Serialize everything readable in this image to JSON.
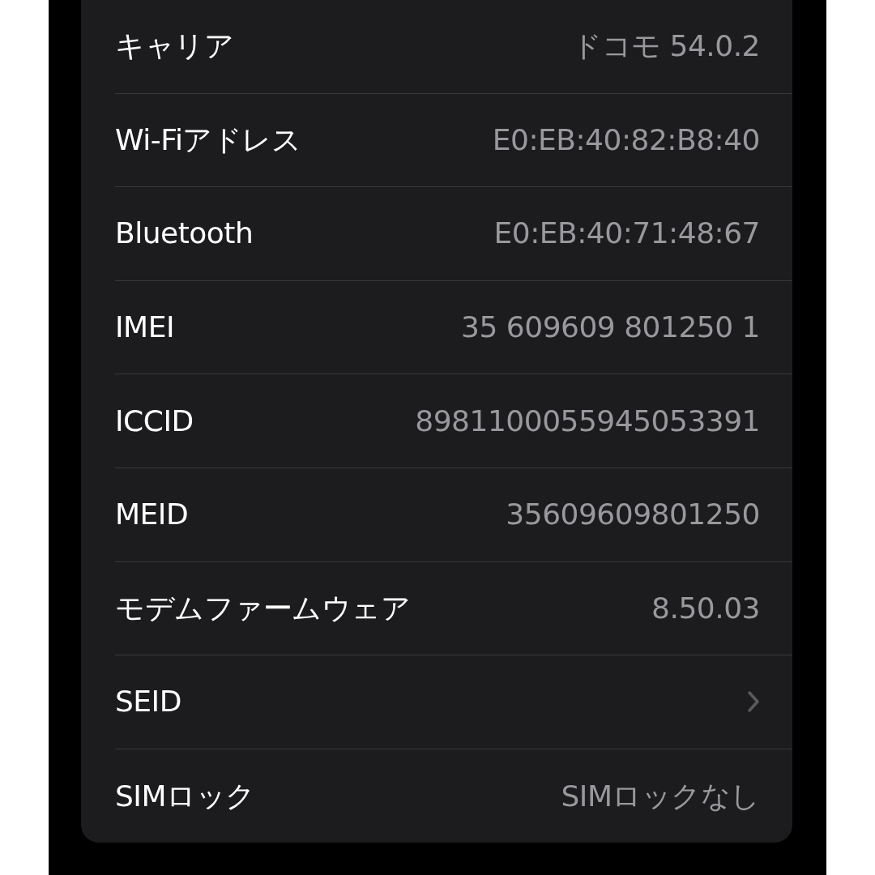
{
  "rows": [
    {
      "kind": "value",
      "label": "キャリア",
      "value": "ドコモ 54.0.2"
    },
    {
      "kind": "value",
      "label": "Wi-Fiアドレス",
      "value": "E0:EB:40:82:B8:40"
    },
    {
      "kind": "value",
      "label": "Bluetooth",
      "value": "E0:EB:40:71:48:67"
    },
    {
      "kind": "value",
      "label": "IMEI",
      "value": "35 609609 801250 1"
    },
    {
      "kind": "value",
      "label": "ICCID",
      "value": "8981100055945053391"
    },
    {
      "kind": "value",
      "label": "MEID",
      "value": "35609609801250"
    },
    {
      "kind": "value",
      "label": "モデムファームウェア",
      "value": "8.50.03"
    },
    {
      "kind": "link",
      "label": "SEID"
    },
    {
      "kind": "value",
      "label": "SIMロック",
      "value": "SIMロックなし"
    }
  ]
}
